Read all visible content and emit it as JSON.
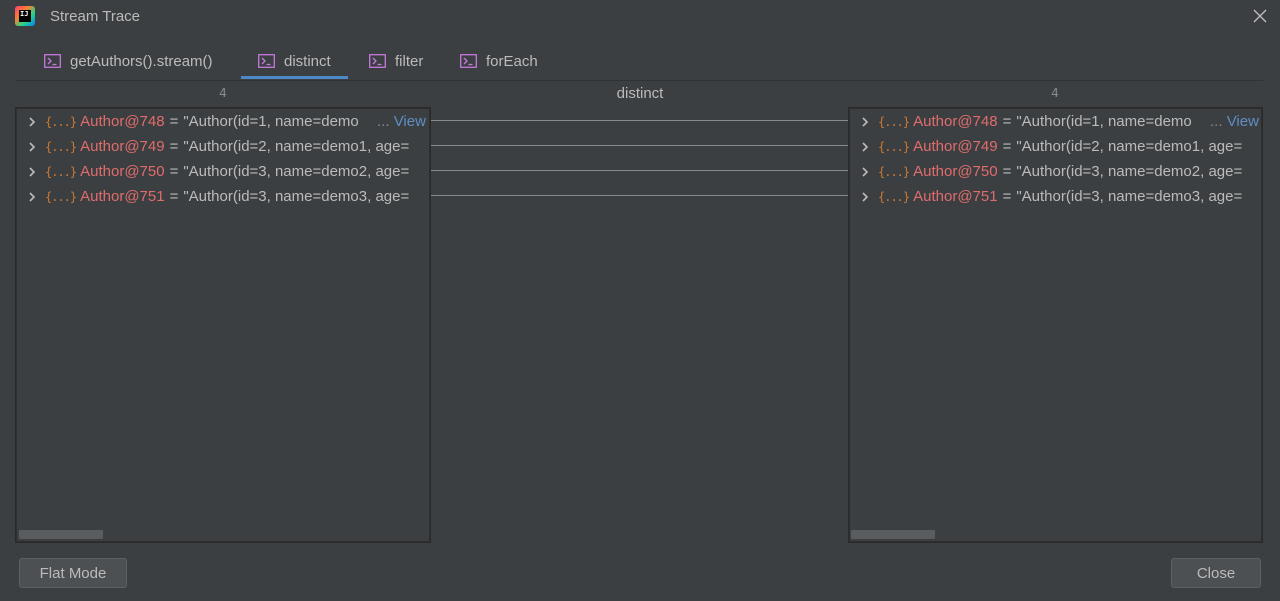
{
  "window": {
    "title": "Stream Trace",
    "logo_icon": "intellij-idea-icon",
    "close_icon": "close-icon"
  },
  "tabs": [
    {
      "label": "getAuthors().stream()",
      "icon": "terminal-icon",
      "active": false
    },
    {
      "label": "distinct",
      "icon": "terminal-icon",
      "active": true
    },
    {
      "label": "filter",
      "icon": "terminal-icon",
      "active": false
    },
    {
      "label": "forEach",
      "icon": "terminal-icon",
      "active": false
    }
  ],
  "panels": {
    "middle_title": "distinct",
    "left": {
      "count": "4",
      "rows": [
        {
          "name": "Author@748",
          "value": "\"Author(id=1, name=demo"
        },
        {
          "name": "Author@749",
          "value": "\"Author(id=2, name=demo1, age="
        },
        {
          "name": "Author@750",
          "value": "\"Author(id=3, name=demo2, age="
        },
        {
          "name": "Author@751",
          "value": "\"Author(id=3, name=demo3, age="
        }
      ],
      "view_label": "View",
      "view_ellipsis": "..."
    },
    "right": {
      "count": "4",
      "rows": [
        {
          "name": "Author@748",
          "value": "\"Author(id=1, name=demo"
        },
        {
          "name": "Author@749",
          "value": "\"Author(id=2, name=demo1, age="
        },
        {
          "name": "Author@750",
          "value": "\"Author(id=3, name=demo2, age="
        },
        {
          "name": "Author@751",
          "value": "\"Author(id=3, name=demo3, age="
        }
      ],
      "view_label": "View",
      "view_ellipsis": "..."
    },
    "equals": "="
  },
  "buttons": {
    "flat_mode": "Flat Mode",
    "close": "Close"
  },
  "colors": {
    "background": "#3c3f41",
    "accent_tab": "#4a88c7",
    "object_name": "#e06c6c",
    "link": "#5e8fc4",
    "object_icon": "#cc7832",
    "tab_icon": "#c678dd"
  }
}
